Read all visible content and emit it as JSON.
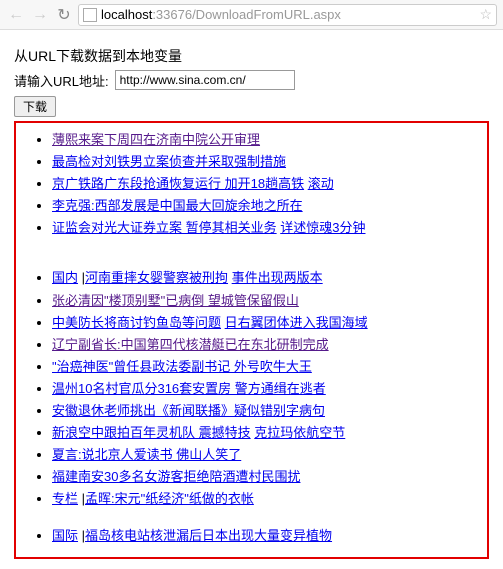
{
  "chrome": {
    "back": "←",
    "forward": "→",
    "reload": "↻",
    "url_prefix": "localhost",
    "url_port_path": ":33676/DownloadFromURL.aspx",
    "star": "☆"
  },
  "page": {
    "heading": "从URL下载数据到本地变量",
    "label": "请输入URL地址:",
    "input_value": "http://www.sina.com.cn/",
    "button": "下载"
  },
  "topnews": [
    {
      "parts": [
        {
          "t": "薄熙来案下周四在济南中院公开审理",
          "v": true
        }
      ]
    },
    {
      "parts": [
        {
          "t": "最高检对刘铁男立案侦查并采取强制措施"
        }
      ]
    },
    {
      "parts": [
        {
          "t": "京广铁路广东段抢通恢复运行 加开18趟高铁"
        },
        {
          "t": " "
        },
        {
          "t": "滚动"
        }
      ]
    },
    {
      "parts": [
        {
          "t": "李克强:西部发展是中国最大回旋余地之所在"
        }
      ]
    },
    {
      "parts": [
        {
          "t": "证监会对光大证券立案 暂停其相关业务"
        },
        {
          "t": " "
        },
        {
          "t": "详述惊魂3分钟"
        }
      ]
    }
  ],
  "domestic": [
    {
      "parts": [
        {
          "t": "国内"
        },
        {
          "sep": " |"
        },
        {
          "t": "河南重摔女婴警察被刑拘"
        },
        {
          "t": " "
        },
        {
          "t": "事件出现两版本"
        }
      ]
    },
    {
      "parts": [
        {
          "t": "张必清因\"楼顶别墅\"已病倒 望城管保留假山",
          "v": true
        }
      ]
    },
    {
      "parts": [
        {
          "t": "中美防长将商讨钓鱼岛等问题"
        },
        {
          "t": " "
        },
        {
          "t": "日右翼团体进入我国海域"
        }
      ]
    },
    {
      "parts": [
        {
          "t": "辽宁副省长:中国第四代核潜艇已在东北研制完成",
          "v": true
        }
      ]
    },
    {
      "parts": [
        {
          "t": "\"治癌神医\"曾任县政法委副书记 外号吹牛大王"
        }
      ]
    },
    {
      "parts": [
        {
          "t": "温州10名村官瓜分316套安置房 警方通缉在逃者"
        }
      ]
    },
    {
      "parts": [
        {
          "t": "安徽退休老师挑出《新闻联播》疑似错别字病句"
        }
      ]
    },
    {
      "parts": [
        {
          "t": "新浪空中跟拍百年灵机队 震撼特技"
        },
        {
          "t": " "
        },
        {
          "t": "克拉玛依航空节"
        }
      ]
    },
    {
      "parts": [
        {
          "t": "夏言:说北京人爱读书 佛山人笑了"
        }
      ]
    },
    {
      "parts": [
        {
          "t": "福建南安30多名女游客拒绝陪酒遭村民围扰"
        }
      ]
    },
    {
      "parts": [
        {
          "t": "专栏"
        },
        {
          "sep": " |"
        },
        {
          "t": "孟晖:宋元\"纸经济\"纸做的衣帐"
        }
      ]
    }
  ],
  "intl": [
    {
      "parts": [
        {
          "t": "国际"
        },
        {
          "sep": " |"
        },
        {
          "t": "福岛核电站核泄漏后日本出现大量变异植物"
        }
      ]
    }
  ]
}
